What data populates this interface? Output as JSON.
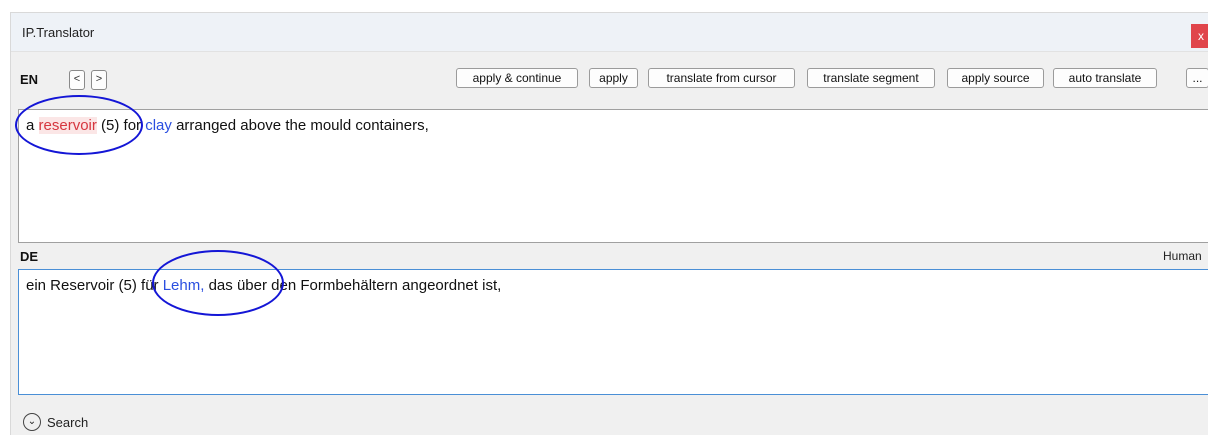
{
  "window": {
    "title": "IP.Translator",
    "close_label": "x"
  },
  "source": {
    "lang": "EN",
    "prev_label": "<",
    "next_label": ">",
    "text": {
      "before": "a ",
      "term1": "reservoir",
      "middle1": " (5) for ",
      "term2": "clay",
      "after": " arranged above the mould containers,"
    }
  },
  "toolbar": {
    "apply_continue": "apply & continue",
    "apply": "apply",
    "translate_from_cursor": "translate from cursor",
    "translate_segment": "translate segment",
    "apply_source": "apply source",
    "auto_translate": "auto translate",
    "more": "..."
  },
  "target": {
    "lang": "DE",
    "status": "Human",
    "text": {
      "before": "ein Reservoir (5) für ",
      "term": "Lehm,",
      "after": " das über den Formbehältern angeordnet ist,"
    }
  },
  "search": {
    "label": "Search",
    "icon": "chevron-down-circle-icon"
  },
  "colors": {
    "term_highlight": "#d6363f",
    "term_blue": "#2b4fe0",
    "annotation": "#1416d6",
    "close_button": "#e0454b"
  }
}
